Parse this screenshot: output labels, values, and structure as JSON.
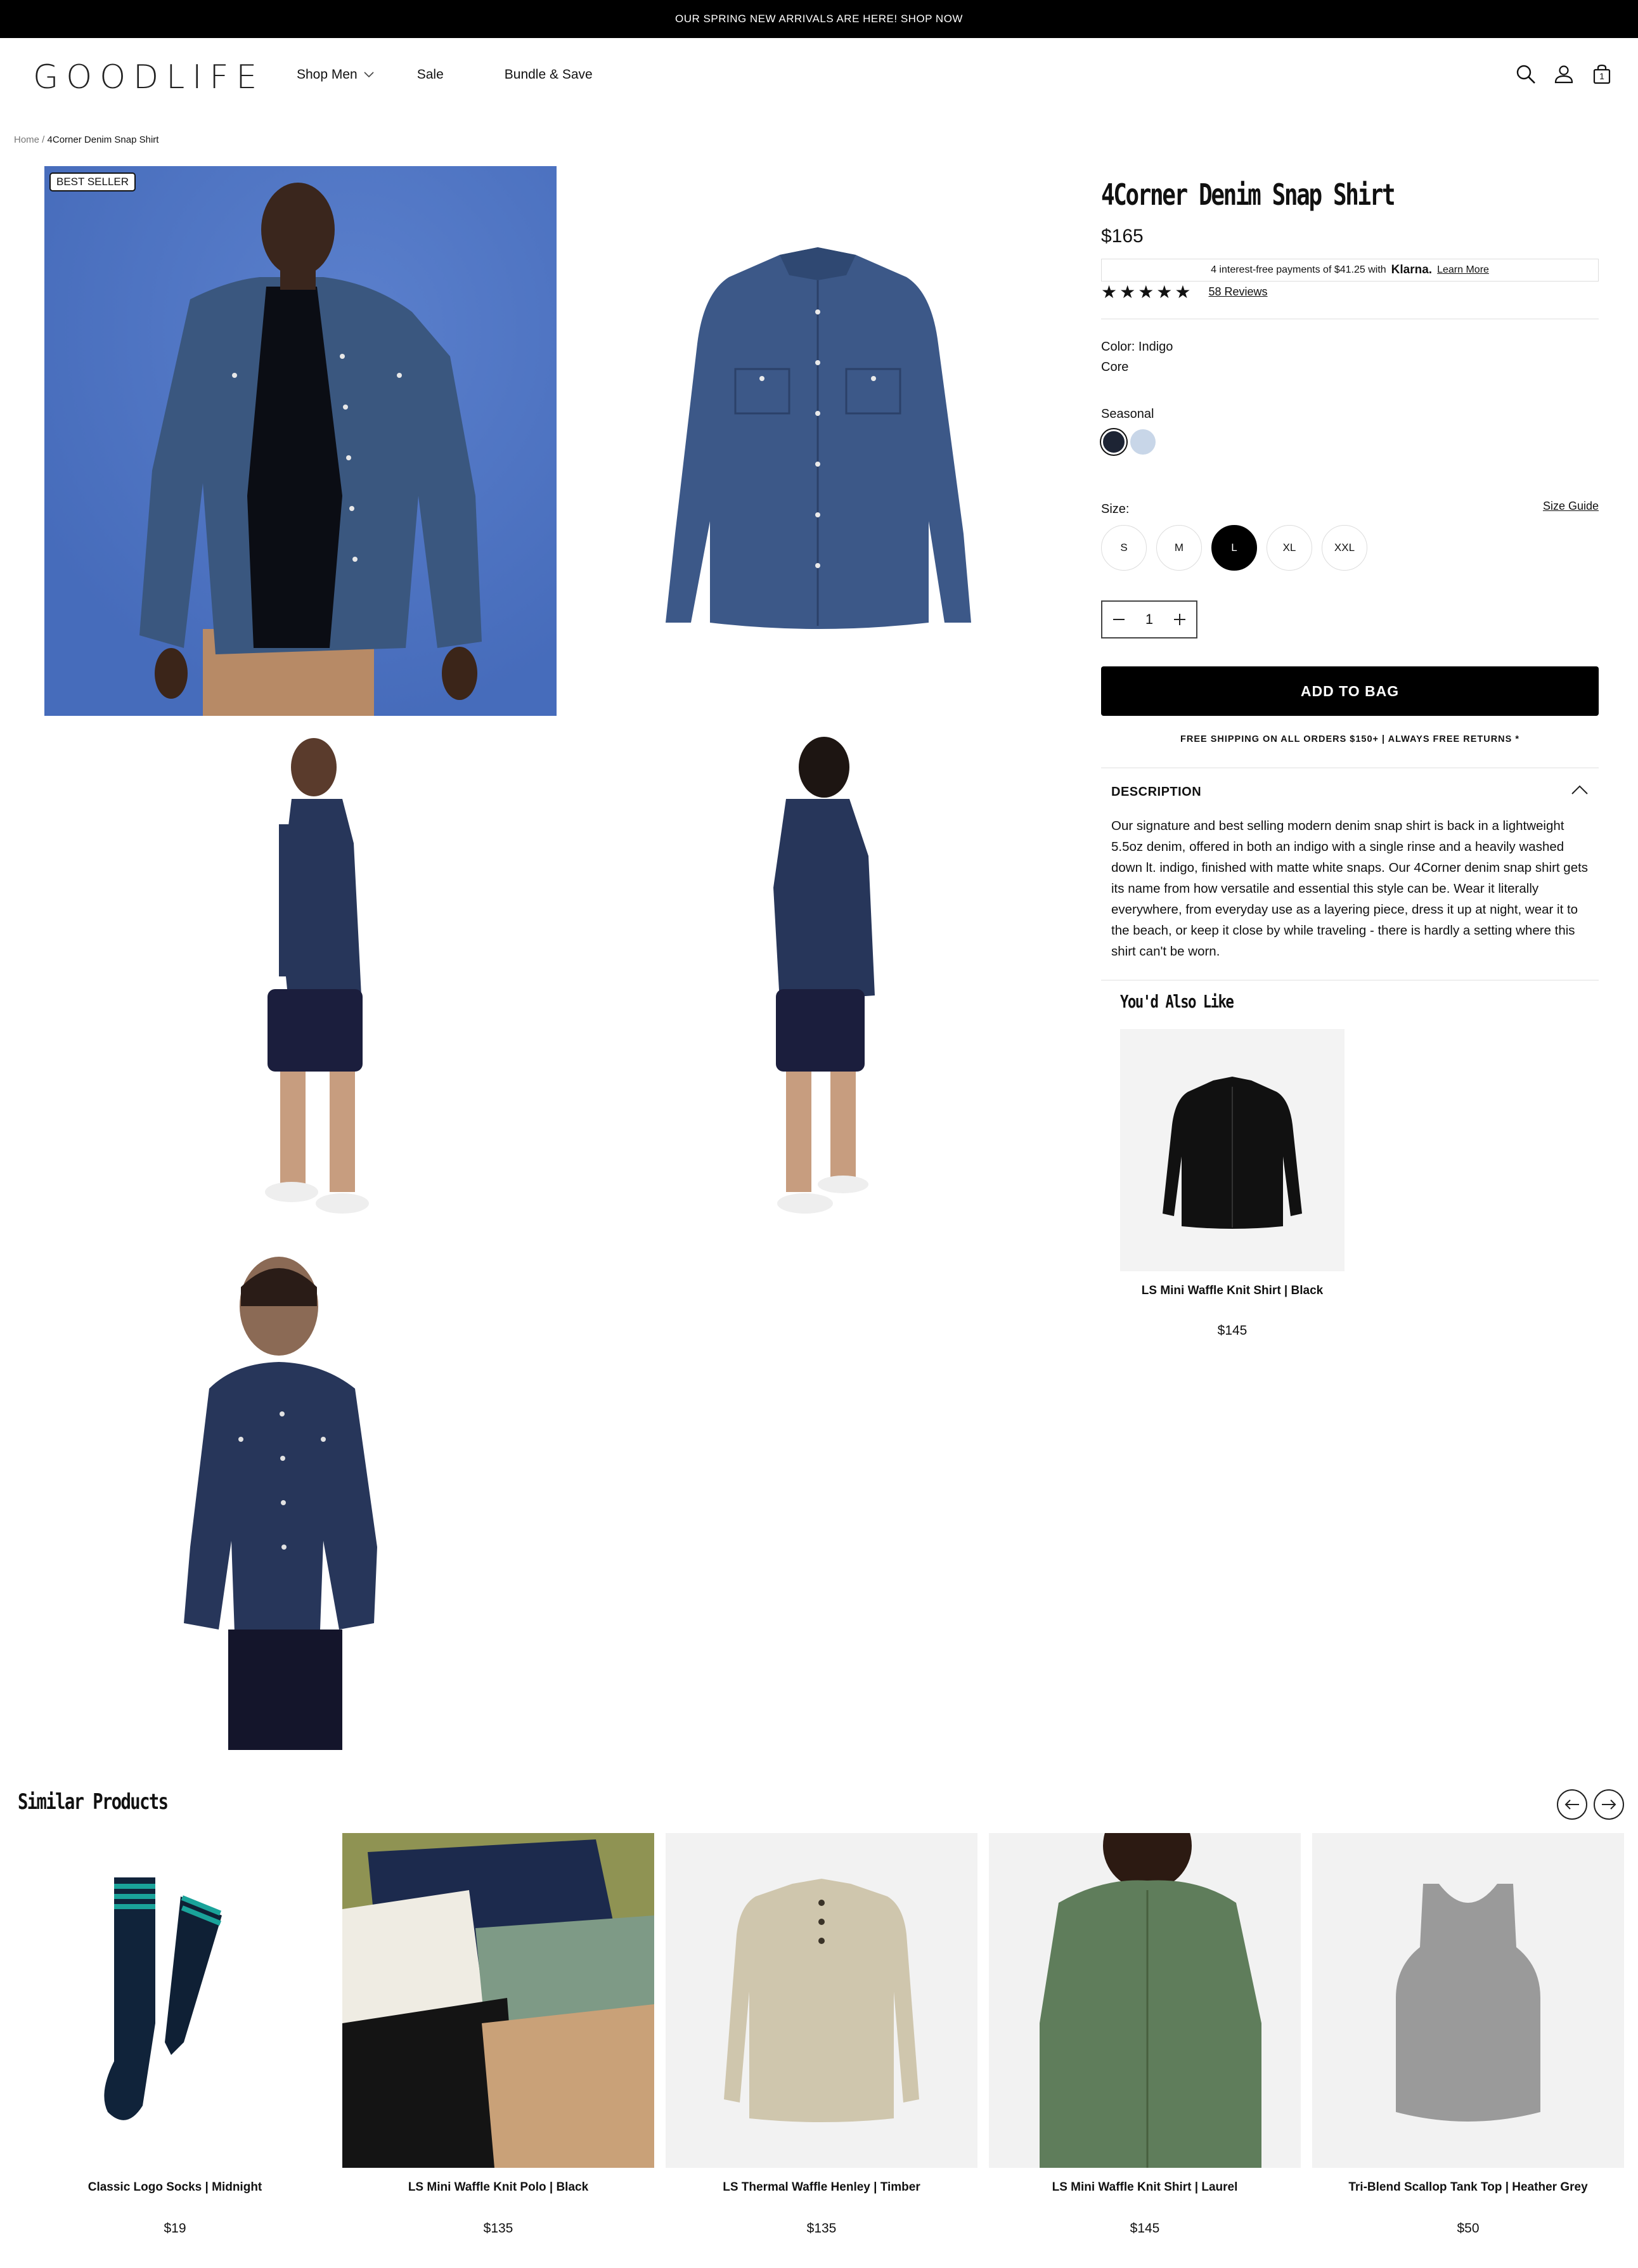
{
  "announcement": "OUR SPRING NEW ARRIVALS ARE HERE! SHOP NOW",
  "header": {
    "logo": "GOODLIFE",
    "nav": [
      "Shop Men",
      "Sale",
      "Bundle & Save"
    ],
    "icons": [
      "search-icon",
      "account-icon",
      "bag-icon"
    ],
    "bag_count": "1"
  },
  "breadcrumb": {
    "home": "Home",
    "separator": " / ",
    "current": "4Corner Denim Snap Shirt"
  },
  "gallery": {
    "badge": "BEST SELLER"
  },
  "product": {
    "title": "4Corner Denim Snap Shirt",
    "price": "$165",
    "klarna": {
      "text": "4 interest-free payments of $41.25 with",
      "brand": "Klarna.",
      "link": "Learn More"
    },
    "stars": "★★★★★",
    "reviews": "58 Reviews",
    "color_label": "Color: Indigo",
    "core_label": "Core",
    "seasonal_label": "Seasonal",
    "swatch_colors": [
      "#1d2434",
      "#c8d6e8"
    ],
    "size_label": "Size:",
    "size_guide": "Size Guide",
    "sizes": [
      "S",
      "M",
      "L",
      "XL",
      "XXL"
    ],
    "selected_size": "L",
    "quantity": "1",
    "add_to_bag": "ADD TO BAG",
    "shipping_note": "FREE SHIPPING ON ALL ORDERS $150+ | ALWAYS FREE RETURNS *",
    "description_heading": "DESCRIPTION",
    "description": "Our signature and best selling modern denim snap shirt is back in a lightweight 5.5oz denim, offered in both an indigo with a single rinse and a heavily washed down lt. indigo, finished with matte white snaps. Our 4Corner denim snap shirt gets its name from how versatile and essential this style can be. Wear it literally everywhere, from everyday use as a layering piece, dress it up at night, wear it to the beach, or keep it close by while traveling - there is hardly a setting where this shirt can't be worn."
  },
  "also_like": {
    "title": "You'd Also Like",
    "items": [
      {
        "name": "LS Mini Waffle Knit Shirt | Black",
        "price": "$145"
      }
    ]
  },
  "similar": {
    "title": "Similar Products",
    "items": [
      {
        "name": "Classic Logo Socks | Midnight",
        "price": "$19"
      },
      {
        "name": "LS Mini Waffle Knit Polo | Black",
        "price": "$135"
      },
      {
        "name": "LS Thermal Waffle Henley | Timber",
        "price": "$135"
      },
      {
        "name": "LS Mini Waffle Knit Shirt | Laurel",
        "price": "$145"
      },
      {
        "name": "Tri-Blend Scallop Tank Top | Heather Grey",
        "price": "$50"
      }
    ]
  },
  "colors": {
    "accent": "#000000",
    "hero_bg": "#4f76c6",
    "denim": "#3b5583",
    "dark_denim": "#27365a"
  }
}
